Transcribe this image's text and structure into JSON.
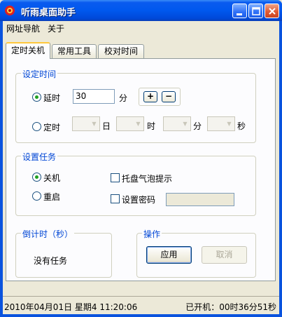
{
  "window": {
    "title": "听雨桌面助手"
  },
  "menu": {
    "items": [
      "网址导航",
      "关于"
    ]
  },
  "tabs": [
    "定时关机",
    "常用工具",
    "校对时间"
  ],
  "set_time": {
    "title": "设定时间",
    "delay_label": "延时",
    "delay_value": "30",
    "delay_unit": "分",
    "plus_label": "+",
    "minus_label": "−",
    "timed_label": "定时",
    "day_unit": "日",
    "hour_unit": "时",
    "minute_unit": "分",
    "second_unit": "秒",
    "selected": "delay"
  },
  "task": {
    "title": "设置任务",
    "shutdown_label": "关机",
    "restart_label": "重启",
    "balloon_label": "托盘气泡提示",
    "password_label": "设置密码",
    "selected": "shutdown"
  },
  "countdown": {
    "title": "倒计时（秒）",
    "status": "没有任务"
  },
  "operate": {
    "title": "操作",
    "apply_label": "应用",
    "cancel_label": "取消"
  },
  "status": {
    "datetime": "2010年04月01日  星期4  11:20:06",
    "uptime": "已开机：00时36分51秒"
  },
  "colors": {
    "title_bar": "#0058ee",
    "group_title": "#0046d5",
    "radio_selected": "#21a121"
  }
}
